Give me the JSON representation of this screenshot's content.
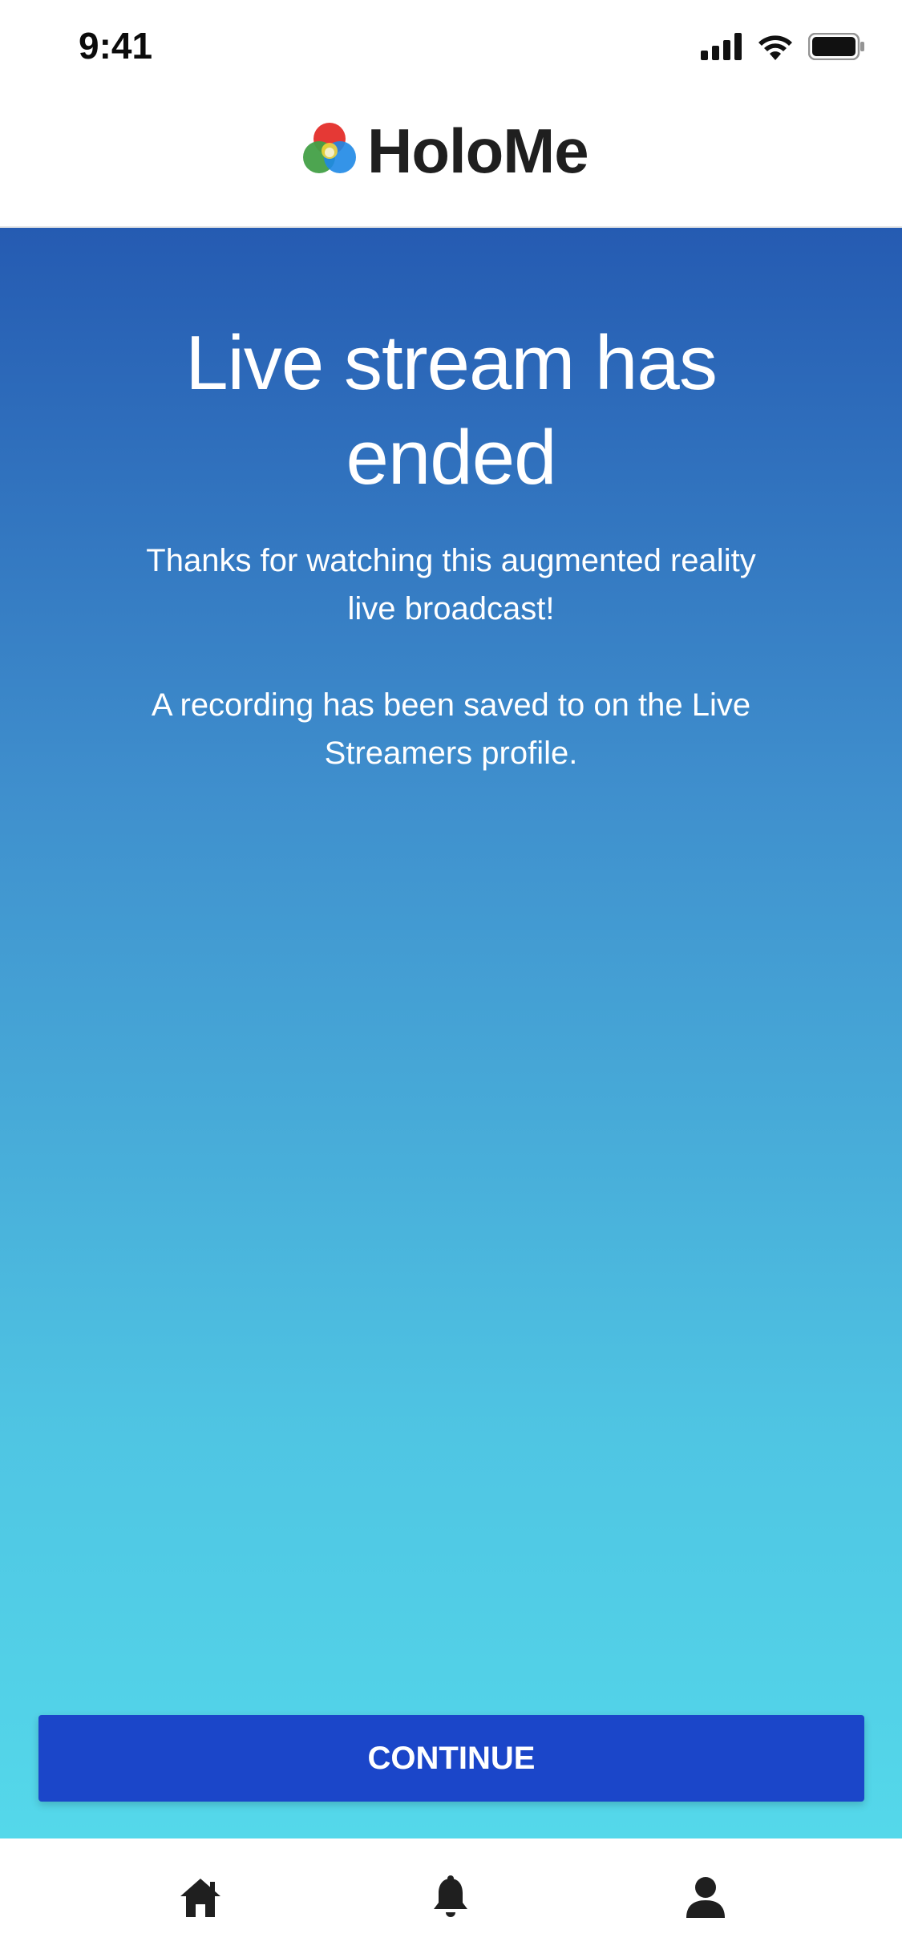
{
  "status_bar": {
    "time": "9:41",
    "icons": [
      "cellular-signal-icon",
      "wifi-icon",
      "battery-icon"
    ]
  },
  "header": {
    "brand_name": "HoloMe",
    "logo_icon": "holome-logo-icon",
    "logo_colors": [
      "#e53935",
      "#43a047",
      "#1e88e5",
      "#fdd835"
    ]
  },
  "main": {
    "headline": "Live stream has ended",
    "body_line_1": "Thanks for watching this augmented reality live broadcast!",
    "body_line_2": "A recording has been saved to on the Live Streamers profile.",
    "gradient_colors": [
      "#255bb2",
      "#54d8ea"
    ]
  },
  "actions": {
    "continue_label": "CONTINUE",
    "button_color": "#1b46c9"
  },
  "tab_bar": {
    "items": [
      {
        "icon": "home-icon"
      },
      {
        "icon": "bell-icon"
      },
      {
        "icon": "user-icon"
      }
    ]
  }
}
